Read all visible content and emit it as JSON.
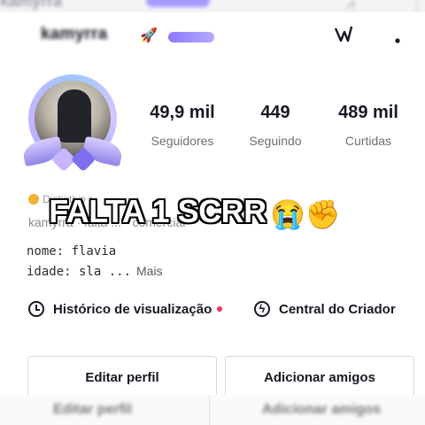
{
  "header": {
    "username": "kamyrra",
    "username_faded": "kamyrra",
    "name_emoji": "🚀",
    "icon_right_1": "footprints-icon",
    "icon_right_2": "more-options-icon"
  },
  "profile": {
    "avatar": "avatar-with-wings-frame"
  },
  "stats": [
    {
      "value": "49,9 mil",
      "label": "Seguidores"
    },
    {
      "value": "449",
      "label": "Seguindo"
    },
    {
      "value": "489 mil",
      "label": "Curtidas"
    }
  ],
  "subtitle": {
    "line1": "Distintivo >",
    "line2": "kamyrra · falta ... · comercial"
  },
  "overlay": {
    "text": "FALTA 1 SCRR",
    "emoji": "😭✊"
  },
  "bio": {
    "line1": "nome: flavia",
    "line2": "idade: sla ...",
    "more_label": "Mais"
  },
  "links": {
    "history_label": "Histórico de visualização",
    "creator_label": "Central do Criador",
    "history_icon": "clock-icon",
    "creator_icon": "lightning-icon",
    "accent_color": "#fe2c55"
  },
  "buttons": {
    "edit_profile": "Editar perfil",
    "add_friends": "Adicionar amigos"
  },
  "bottom_ghost": {
    "edit_profile": "Editar perfil",
    "add_friends": "Adicionar amigos"
  }
}
